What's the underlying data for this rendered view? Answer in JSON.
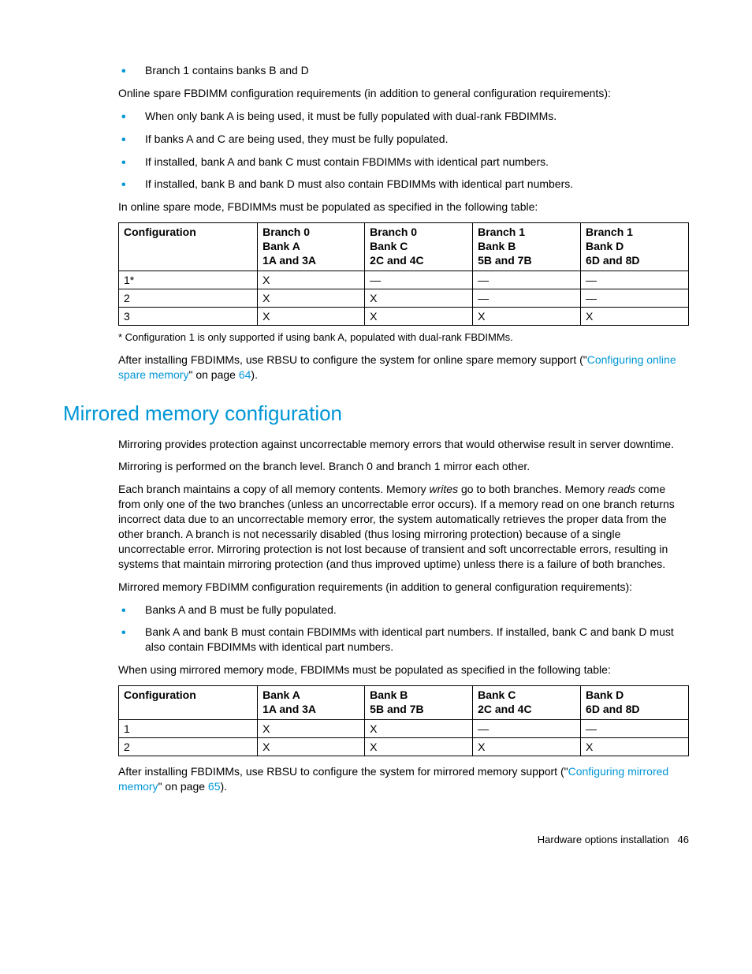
{
  "top_bullets": [
    "Branch 1 contains banks B and D"
  ],
  "p_after_top": "Online spare FBDIMM configuration requirements (in addition to general configuration requirements):",
  "req_bullets": [
    "When only bank A is being used, it must be fully populated with dual-rank FBDIMMs.",
    "If banks A and C are being used, they must be fully populated.",
    "If installed, bank A and bank C must contain FBDIMMs with identical part numbers.",
    "If installed, bank B and bank D must also contain FBDIMMs with identical part numbers."
  ],
  "p_table_intro1": "In online spare mode, FBDIMMs must be populated as specified in the following table:",
  "table1": {
    "headers": [
      [
        "Configuration"
      ],
      [
        "Branch 0",
        "Bank A",
        "1A and 3A"
      ],
      [
        "Branch 0",
        "Bank C",
        "2C and 4C"
      ],
      [
        "Branch 1",
        "Bank B",
        "5B and 7B"
      ],
      [
        "Branch 1",
        "Bank D",
        "6D and 8D"
      ]
    ],
    "rows": [
      [
        "1*",
        "X",
        "—",
        "—",
        "—"
      ],
      [
        "2",
        "X",
        "X",
        "—",
        "—"
      ],
      [
        "3",
        "X",
        "X",
        "X",
        "X"
      ]
    ]
  },
  "table1_note": "* Configuration 1 is only supported if using bank A, populated with dual-rank FBDIMMs.",
  "p_rbsu1_pre": "After installing FBDIMMs, use RBSU to configure the system for online spare memory support (\"",
  "link1_text": "Configuring online spare memory",
  "p_rbsu1_mid": "\" on page ",
  "link1_page": "64",
  "p_rbsu1_post": ").",
  "section_title": "Mirrored memory configuration",
  "mirror_p1": "Mirroring provides protection against uncorrectable memory errors that would otherwise result in server downtime.",
  "mirror_p2": "Mirroring is performed on the branch level. Branch 0 and branch 1 mirror each other.",
  "mirror_p3_a": "Each branch maintains a copy of all memory contents. Memory ",
  "mirror_p3_w": "writes",
  "mirror_p3_b": " go to both branches. Memory ",
  "mirror_p3_r": "reads",
  "mirror_p3_c": " come from only one of the two branches (unless an uncorrectable error occurs). If a memory read on one branch returns incorrect data due to an uncorrectable memory error, the system automatically retrieves the proper data from the other branch. A branch is not necessarily disabled (thus losing mirroring protection) because of a single uncorrectable error. Mirroring protection is not lost because of transient and soft uncorrectable errors, resulting in systems that maintain mirroring protection (and thus improved uptime) unless there is a failure of both branches.",
  "mirror_p4": "Mirrored memory FBDIMM configuration requirements (in addition to general configuration requirements):",
  "mirror_bullets": [
    "Banks A and B must be fully populated.",
    "Bank A and bank B must contain FBDIMMs with identical part numbers. If installed, bank C and bank D must also contain FBDIMMs with identical part numbers."
  ],
  "p_table_intro2": "When using mirrored memory mode, FBDIMMs must be populated as specified in the following table:",
  "table2": {
    "headers": [
      [
        "Configuration"
      ],
      [
        "Bank A",
        "1A and 3A"
      ],
      [
        "Bank B",
        "5B and 7B"
      ],
      [
        "Bank C",
        "2C and 4C"
      ],
      [
        "Bank D",
        "6D and 8D"
      ]
    ],
    "rows": [
      [
        "1",
        "X",
        "X",
        "—",
        "—"
      ],
      [
        "2",
        "X",
        "X",
        "X",
        "X"
      ]
    ]
  },
  "p_rbsu2_pre": "After installing FBDIMMs, use RBSU to configure the system for mirrored memory support (\"",
  "link2_text": "Configuring mirrored memory",
  "p_rbsu2_mid": "\" on page ",
  "link2_page": "65",
  "p_rbsu2_post": ").",
  "footer_text": "Hardware options installation",
  "footer_page": "46"
}
